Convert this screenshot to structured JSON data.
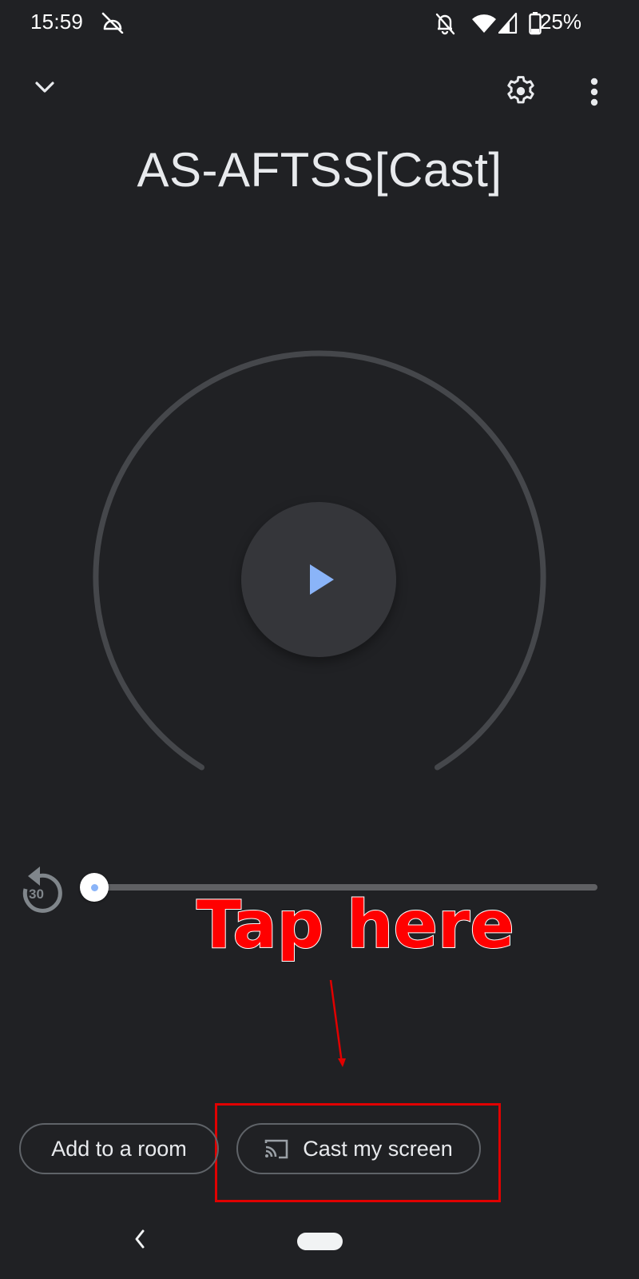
{
  "status_bar": {
    "time": "15:59",
    "left_icons": [
      "cloud-off-icon"
    ],
    "right_icons": [
      "notifications-off-icon",
      "wifi-icon",
      "cellular-signal-icon",
      "battery-icon"
    ],
    "battery_percent": "25%"
  },
  "top_bar": {
    "collapse_icon": "chevron-down-icon",
    "settings_icon": "gear-icon",
    "more_icon": "more-vert-icon"
  },
  "device": {
    "title": "AS-AFTSS[Cast]"
  },
  "player": {
    "play_icon": "play-icon",
    "accent_color": "#8ab4f8",
    "replay_label": "30",
    "replay_icon": "replay-30-icon",
    "seek_progress": 0.0
  },
  "annotation": {
    "text": "Tap here",
    "color": "#ff0000"
  },
  "actions": {
    "add_to_room": "Add to a room",
    "cast_my_screen": "Cast my screen",
    "cast_icon": "cast-icon"
  },
  "nav_bar": {
    "back_icon": "back-icon",
    "home_icon": "home-pill-icon"
  }
}
